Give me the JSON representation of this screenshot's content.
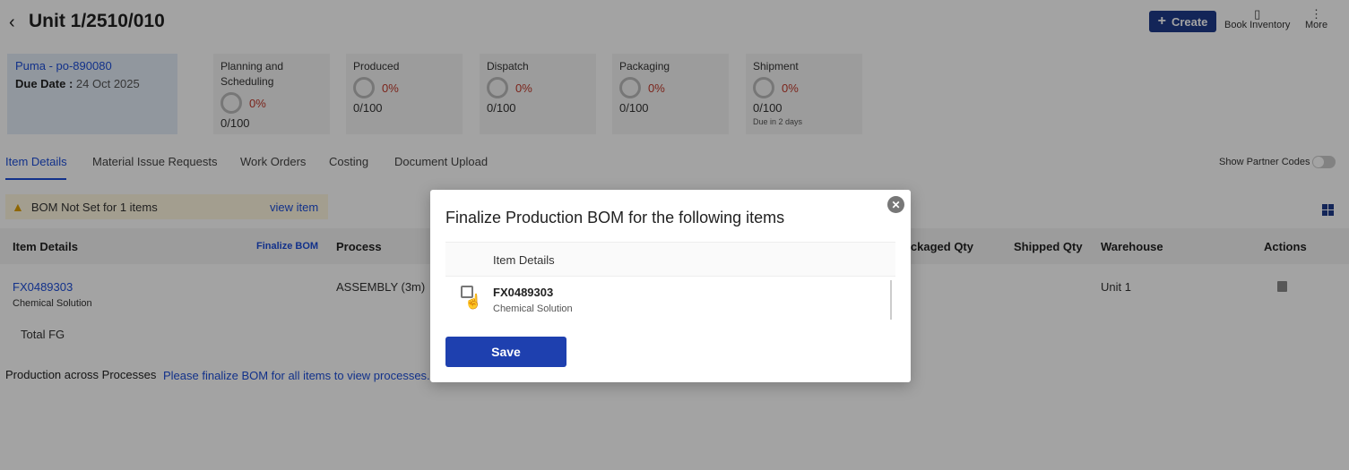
{
  "header": {
    "title": "Unit 1/2510/010",
    "create_label": "Create",
    "book_inventory_label": "Book Inventory",
    "more_label": "More"
  },
  "po_card": {
    "po": "Puma - po-890080",
    "due_label": "Due Date :",
    "due_value": "24 Oct 2025"
  },
  "stages": [
    {
      "name": "Planning and Scheduling",
      "percent": "0%",
      "count": "0/100",
      "note": ""
    },
    {
      "name": "Produced",
      "percent": "0%",
      "count": "0/100",
      "note": ""
    },
    {
      "name": "Dispatch",
      "percent": "0%",
      "count": "0/100",
      "note": ""
    },
    {
      "name": "Packaging",
      "percent": "0%",
      "count": "0/100",
      "note": ""
    },
    {
      "name": "Shipment",
      "percent": "0%",
      "count": "0/100",
      "note": "Due in 2 days"
    }
  ],
  "tabs": [
    "Item Details",
    "Material Issue Requests",
    "Work Orders",
    "Costing",
    "Document Upload"
  ],
  "show_partner_codes": "Show Partner Codes",
  "warning": {
    "text": "BOM Not Set for 1 items",
    "link": "view item"
  },
  "table": {
    "headers": {
      "item_details": "Item Details",
      "finalize_bom": "Finalize BOM",
      "process": "Process",
      "packaged_qty": "Packaged Qty",
      "shipped_qty": "Shipped Qty",
      "warehouse": "Warehouse",
      "actions": "Actions"
    },
    "row": {
      "code": "FX0489303",
      "description": "Chemical Solution",
      "process": "ASSEMBLY (3m)",
      "warehouse": "Unit 1"
    },
    "total_label": "Total FG"
  },
  "production": {
    "label": "Production across Processes",
    "message": "Please finalize BOM for all items to view processes."
  },
  "modal": {
    "title": "Finalize Production BOM for the following items",
    "column_header": "Item Details",
    "item_code": "FX0489303",
    "item_desc": "Chemical Solution",
    "save_label": "Save",
    "close_icon": "close-icon"
  },
  "colors": {
    "primary": "#1e3a8a",
    "link": "#1d4ed8",
    "percent": "#c0392b",
    "warning_bg": "#fff7e0"
  }
}
